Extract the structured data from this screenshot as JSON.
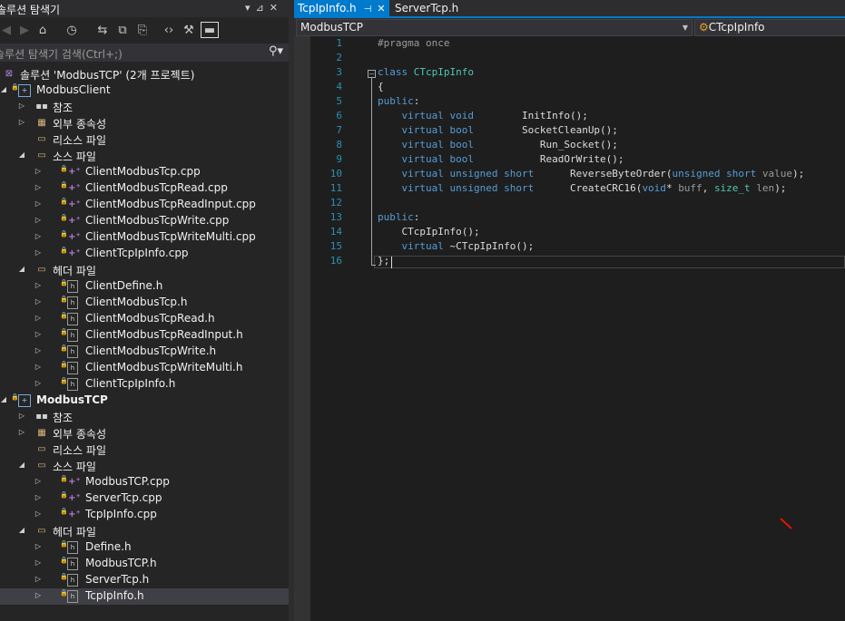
{
  "explorer": {
    "title": "솔루션 탐색기",
    "title_buttons": [
      "▾",
      "⊿",
      "✕"
    ],
    "search_placeholder": "솔루션 탐색기 검색(Ctrl+;)",
    "tree": [
      {
        "label": "솔루션 'ModbusTCP' (2개 프로젝트)",
        "icon": "solution-icon",
        "level": 0,
        "expander": "",
        "bold": false
      },
      {
        "label": "ModbusClient",
        "icon": "project-icon",
        "level": 0,
        "expander": "expanded",
        "bold": false
      },
      {
        "label": "참조",
        "icon": "references-icon",
        "level": 1,
        "expander": "collapsed",
        "bold": false
      },
      {
        "label": "외부 종속성",
        "icon": "dependencies-icon",
        "level": 1,
        "expander": "collapsed",
        "bold": false
      },
      {
        "label": "리소스 파일",
        "icon": "folder-icon",
        "level": 1,
        "expander": "",
        "bold": false
      },
      {
        "label": "소스 파일",
        "icon": "folder-icon",
        "level": 1,
        "expander": "expanded",
        "bold": false
      },
      {
        "label": "ClientModbusTcp.cpp",
        "icon": "cpp-file-icon",
        "level": 2,
        "expander": "collapsed",
        "bold": false
      },
      {
        "label": "ClientModbusTcpRead.cpp",
        "icon": "cpp-file-icon",
        "level": 2,
        "expander": "collapsed",
        "bold": false
      },
      {
        "label": "ClientModbusTcpReadInput.cpp",
        "icon": "cpp-file-icon",
        "level": 2,
        "expander": "collapsed",
        "bold": false
      },
      {
        "label": "ClientModbusTcpWrite.cpp",
        "icon": "cpp-file-icon",
        "level": 2,
        "expander": "collapsed",
        "bold": false
      },
      {
        "label": "ClientModbusTcpWriteMulti.cpp",
        "icon": "cpp-file-icon",
        "level": 2,
        "expander": "collapsed",
        "bold": false
      },
      {
        "label": "ClientTcpIpInfo.cpp",
        "icon": "cpp-file-icon",
        "level": 2,
        "expander": "collapsed",
        "bold": false
      },
      {
        "label": "헤더 파일",
        "icon": "folder-icon",
        "level": 1,
        "expander": "expanded",
        "bold": false
      },
      {
        "label": "ClientDefine.h",
        "icon": "header-file-icon",
        "level": 2,
        "expander": "collapsed",
        "bold": false
      },
      {
        "label": "ClientModbusTcp.h",
        "icon": "header-file-icon",
        "level": 2,
        "expander": "collapsed",
        "bold": false
      },
      {
        "label": "ClientModbusTcpRead.h",
        "icon": "header-file-icon",
        "level": 2,
        "expander": "collapsed",
        "bold": false
      },
      {
        "label": "ClientModbusTcpReadInput.h",
        "icon": "header-file-icon",
        "level": 2,
        "expander": "collapsed",
        "bold": false
      },
      {
        "label": "ClientModbusTcpWrite.h",
        "icon": "header-file-icon",
        "level": 2,
        "expander": "collapsed",
        "bold": false
      },
      {
        "label": "ClientModbusTcpWriteMulti.h",
        "icon": "header-file-icon",
        "level": 2,
        "expander": "collapsed",
        "bold": false
      },
      {
        "label": "ClientTcpIpInfo.h",
        "icon": "header-file-icon",
        "level": 2,
        "expander": "collapsed",
        "bold": false
      },
      {
        "label": "ModbusTCP",
        "icon": "project-icon",
        "level": 0,
        "expander": "expanded",
        "bold": true
      },
      {
        "label": "참조",
        "icon": "references-icon",
        "level": 1,
        "expander": "collapsed",
        "bold": false
      },
      {
        "label": "외부 종속성",
        "icon": "dependencies-icon",
        "level": 1,
        "expander": "collapsed",
        "bold": false
      },
      {
        "label": "리소스 파일",
        "icon": "folder-icon",
        "level": 1,
        "expander": "",
        "bold": false
      },
      {
        "label": "소스 파일",
        "icon": "folder-icon",
        "level": 1,
        "expander": "expanded",
        "bold": false
      },
      {
        "label": "ModbusTCP.cpp",
        "icon": "cpp-file-icon",
        "level": 2,
        "expander": "collapsed",
        "bold": false
      },
      {
        "label": "ServerTcp.cpp",
        "icon": "cpp-file-icon",
        "level": 2,
        "expander": "collapsed",
        "bold": false
      },
      {
        "label": "TcpIpInfo.cpp",
        "icon": "cpp-file-icon",
        "level": 2,
        "expander": "collapsed",
        "bold": false
      },
      {
        "label": "헤더 파일",
        "icon": "folder-icon",
        "level": 1,
        "expander": "expanded",
        "bold": false
      },
      {
        "label": "Define.h",
        "icon": "header-file-icon",
        "level": 2,
        "expander": "collapsed",
        "bold": false
      },
      {
        "label": "ModbusTCP.h",
        "icon": "header-file-icon",
        "level": 2,
        "expander": "collapsed",
        "bold": false
      },
      {
        "label": "ServerTcp.h",
        "icon": "header-file-icon",
        "level": 2,
        "expander": "collapsed",
        "bold": false
      },
      {
        "label": "TcpIpInfo.h",
        "icon": "header-file-icon",
        "level": 2,
        "expander": "collapsed",
        "bold": false,
        "selected": true
      }
    ]
  },
  "tabs": [
    {
      "label": "TcpIpInfo.h",
      "active": true,
      "pin": "⊣",
      "close": "✕"
    },
    {
      "label": "ServerTcp.h",
      "active": false
    }
  ],
  "navbar": {
    "project": "ModbusTCP",
    "class_scope": "CTcpIpInfo"
  },
  "code_lines": [
    "#pragma once",
    "",
    "class CTcpIpInfo",
    "{",
    "public:",
    "    virtual void        InitInfo();",
    "    virtual bool        SocketCleanUp();",
    "    virtual bool           Run_Socket();",
    "    virtual bool           ReadOrWrite();",
    "    virtual unsigned short      ReverseByteOrder(unsigned short value);",
    "    virtual unsigned short      CreateCRC16(void* buff, size_t len);",
    "",
    "public:",
    "    CTcpIpInfo();",
    "    virtual ~CTcpIpInfo();",
    "};"
  ],
  "line_numbers": [
    "1",
    "2",
    "3",
    "4",
    "5",
    "6",
    "7",
    "8",
    "9",
    "10",
    "11",
    "12",
    "13",
    "14",
    "15",
    "16"
  ],
  "colors": {
    "accent": "#007acc",
    "keyword": "#569cd6",
    "type": "#4ec9b0",
    "line_number": "#2b91af",
    "background": "#1e1e1e"
  }
}
